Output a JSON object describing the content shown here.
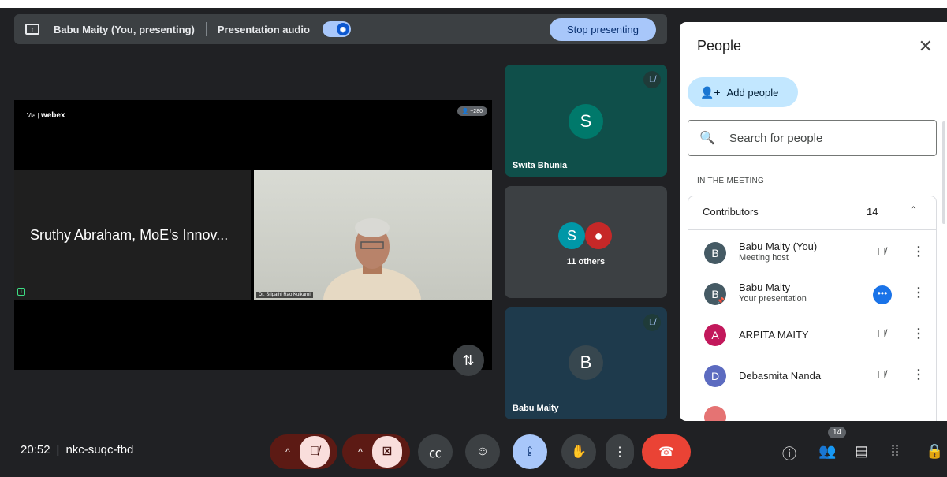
{
  "presenting": {
    "label": "Babu Maity (You, presenting)",
    "audio_label": "Presentation audio",
    "stop_label": "Stop presenting"
  },
  "shared_screen": {
    "via": "Via",
    "app": "webex",
    "participant_count": "+280",
    "name_tile": "Sruthy Abraham, MoE's Innov...",
    "video_label": "Dr. Sripathi Rao Kulkarni"
  },
  "tiles": [
    {
      "initial": "S",
      "name": "Swita Bhunia",
      "muted": true,
      "color": "#00796b"
    },
    {
      "initial": "S",
      "name": "11 others",
      "color": "#0097a7"
    },
    {
      "initial": "B",
      "name": "Babu Maity",
      "muted": true,
      "color": "#37474f"
    }
  ],
  "bottom": {
    "time": "20:52",
    "meeting_code": "nkc-suqc-fbd",
    "people_badge": "14"
  },
  "panel": {
    "title": "People",
    "add_label": "Add people",
    "search_placeholder": "Search for people",
    "section": "IN THE MEETING",
    "contributors_label": "Contributors",
    "contributors_count": "14",
    "people": [
      {
        "initial": "B",
        "name": "Babu Maity (You)",
        "sub": "Meeting host",
        "color": "#455a64"
      },
      {
        "initial": "B",
        "name": "Babu Maity",
        "sub": "Your presentation",
        "color": "#455a64"
      },
      {
        "initial": "A",
        "name": "ARPITA MAITY",
        "color": "#c2185b"
      },
      {
        "initial": "D",
        "name": "Debasmita Nanda",
        "color": "#5c6bc0"
      }
    ]
  },
  "colors": {
    "accent": "#a8c7fa",
    "end_call": "#ea4335",
    "stage": "#202124"
  }
}
